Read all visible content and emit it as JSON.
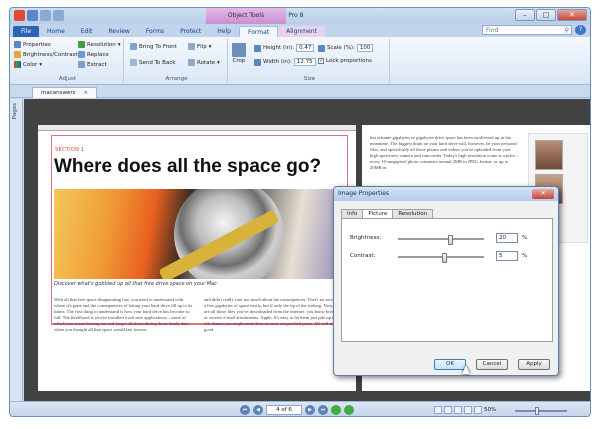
{
  "window": {
    "title": "macanswers.pdf - Nitro Pro 8",
    "contextual_group": "Object Tools"
  },
  "ribbon_tabs": [
    "File",
    "Home",
    "Edit",
    "Review",
    "Forms",
    "Protect",
    "Help",
    "Format",
    "Alignment"
  ],
  "search": {
    "placeholder": "Find"
  },
  "ribbon": {
    "adjust": {
      "label": "Adjust",
      "properties": "Properties",
      "brightness_contrast": "Brightness/Contrast",
      "color": "Color",
      "resolution": "Resolution",
      "replace": "Replace",
      "extract": "Extract"
    },
    "arrange": {
      "label": "Arrange",
      "bring_front": "Bring To Front",
      "send_back": "Send To Back",
      "flip": "Flip",
      "rotate": "Rotate"
    },
    "size": {
      "label": "Size",
      "crop": "Crop",
      "height_label": "Height (in):",
      "height_value": "0.47",
      "width_label": "Width (in):",
      "width_value": "12.75",
      "scale_label": "Scale (%):",
      "scale_value": "100",
      "lock": "Lock proportions"
    }
  },
  "doc_tab": {
    "name": "macanswers",
    "close": "×"
  },
  "pages_pane": {
    "label": "Pages"
  },
  "document": {
    "section": "SECTION 1",
    "headline": "Where does all the space go?",
    "caption": "Discover what's gobbled up all that free drive space on your Mac",
    "col1": "With all that free space disappearing fast, you need to understand with where it's gone and the consequences of letting your hard drive fill up to its limits. The first thing to understand is how your hard drive has become so full. The likelihood is you've installed a raft new applications – some of which you wrote-freeing out and forgot all about during those heady days when you thought all that space would last forever",
    "col2": "and didn't really care too much about the consequences. That's no secret for a few gigabytes of space easily, but if only the tip of the iceberg. Now, there are all those files you've downloaded from the internet: you know browsers or receive e-mail attachments. Apple. It's easy to let them just pile up on the off-chance you might need them at some unspecified point. All will and good",
    "page2_text": "but reframe gigabytes or gigabytes drive space has been swallowed up in the meantime. The biggest drain on your hard drive will, however, be your personal files, and specifically all those photos and videos you've uploaded from your high speed new camera and camcorder. Today's high resolution come at a price – every 10-megapixel photo consumes around 4MB in JPEG format, or up to 20MB in"
  },
  "dialog": {
    "title": "Image Properties",
    "tabs": [
      "Info",
      "Picture",
      "Resolution"
    ],
    "brightness_label": "Brightness:",
    "brightness_value": "20",
    "contrast_label": "Contrast:",
    "contrast_value": "5",
    "unit": "%",
    "ok": "OK",
    "cancel": "Cancel",
    "apply": "Apply",
    "brightness_level": 0.6,
    "contrast_level": 0.53
  },
  "status": {
    "page": "4 of 6",
    "zoom": "50%"
  }
}
